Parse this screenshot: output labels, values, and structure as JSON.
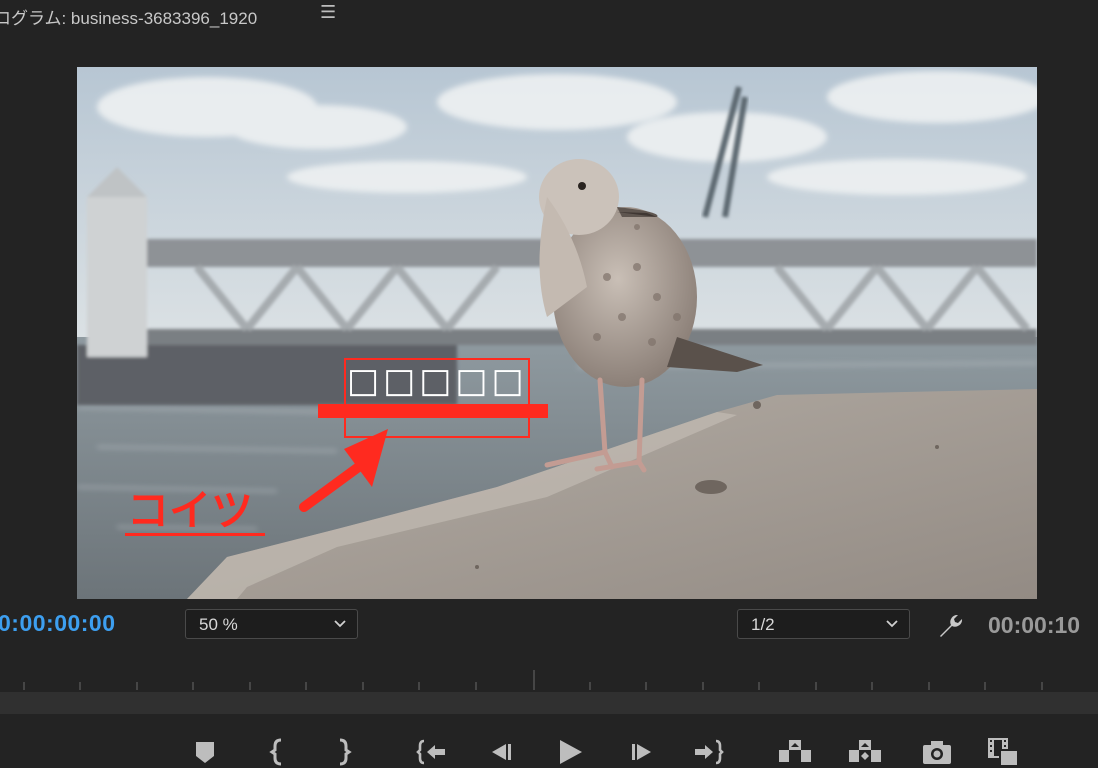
{
  "panel": {
    "title": "ログラム: business-3683396_1920",
    "menu_icon": "hamburger-menu-icon"
  },
  "video": {
    "overlay_text": "□□□□□",
    "annotation_label": "コイツ",
    "annotation_color": "#ff2a1f"
  },
  "controls": {
    "current_timecode": "0:00:00:00",
    "zoom_level": "50 %",
    "resolution": "1/2",
    "duration_timecode": "00:00:10",
    "timecode_color": "#3d9ff0"
  },
  "transport": {
    "buttons": [
      "add-marker-icon",
      "mark-in-icon",
      "mark-out-icon",
      "go-to-in-icon",
      "step-back-icon",
      "play-icon",
      "step-forward-icon",
      "go-to-out-icon",
      "lift-icon",
      "extract-icon",
      "export-frame-icon",
      "compare-view-icon"
    ]
  }
}
